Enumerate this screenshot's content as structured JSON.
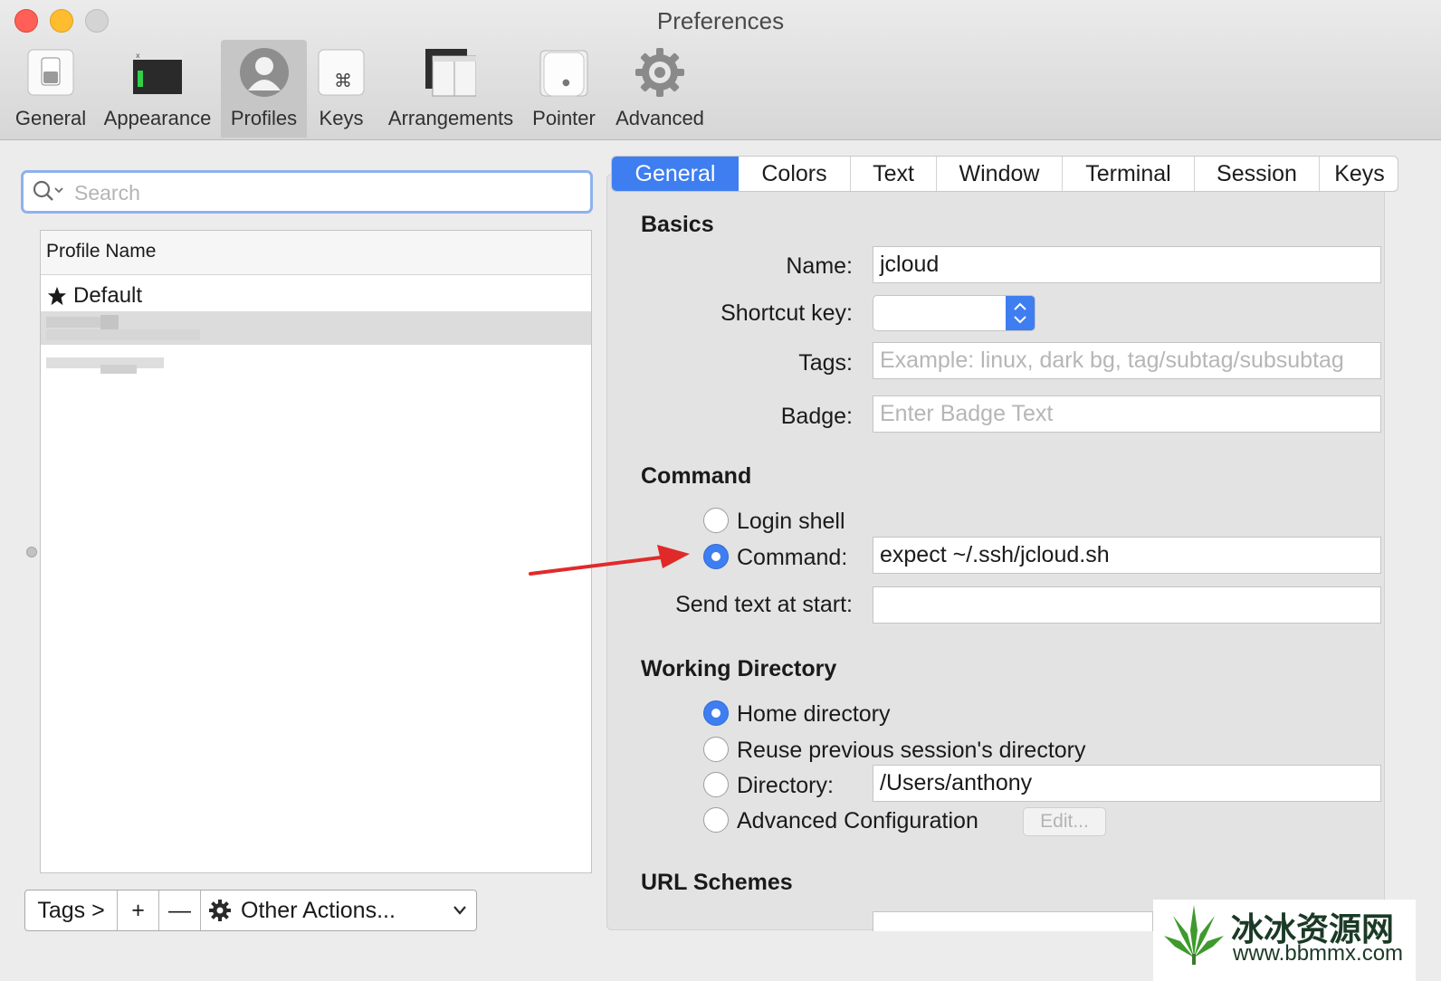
{
  "window": {
    "title": "Preferences"
  },
  "toolbar": {
    "items": [
      {
        "label": "General",
        "icon": "general-switch-icon"
      },
      {
        "label": "Appearance",
        "icon": "appearance-terminal-icon"
      },
      {
        "label": "Profiles",
        "icon": "profiles-user-icon",
        "selected": true
      },
      {
        "label": "Keys",
        "icon": "keys-command-icon"
      },
      {
        "label": "Arrangements",
        "icon": "arrangements-windows-icon"
      },
      {
        "label": "Pointer",
        "icon": "pointer-mouse-icon"
      },
      {
        "label": "Advanced",
        "icon": "advanced-gear-icon"
      }
    ]
  },
  "sidebar": {
    "search_placeholder": "Search",
    "column_header": "Profile Name",
    "profiles": [
      {
        "name": "Default",
        "default": true
      }
    ],
    "bottom_bar": {
      "tags": "Tags >",
      "add": "+",
      "remove": "—",
      "other_actions": "Other Actions..."
    }
  },
  "tabs": [
    "General",
    "Colors",
    "Text",
    "Window",
    "Terminal",
    "Session",
    "Keys"
  ],
  "active_tab": "General",
  "basics": {
    "heading": "Basics",
    "name_label": "Name:",
    "name_value": "jcloud",
    "shortcut_label": "Shortcut key:",
    "tags_label": "Tags:",
    "tags_placeholder": "Example: linux, dark bg, tag/subtag/subsubtag",
    "badge_label": "Badge:",
    "badge_placeholder": "Enter Badge Text"
  },
  "command": {
    "heading": "Command",
    "login_shell": "Login shell",
    "command_label": "Command:",
    "command_value": "expect ~/.ssh/jcloud.sh",
    "selected": "Command",
    "send_text_label": "Send text at start:",
    "send_text_value": ""
  },
  "working_directory": {
    "heading": "Working Directory",
    "home": "Home directory",
    "reuse": "Reuse previous session's directory",
    "directory_label": "Directory:",
    "directory_value": "/Users/anthony",
    "advanced": "Advanced Configuration",
    "edit_button": "Edit...",
    "selected": "Home directory"
  },
  "url_schemes": {
    "heading": "URL Schemes"
  },
  "colors": {
    "accent": "#3e7ef0",
    "arrow": "#e02a2a"
  },
  "watermark": {
    "text": "冰冰资源网",
    "url": "www.bbmmx.com"
  }
}
